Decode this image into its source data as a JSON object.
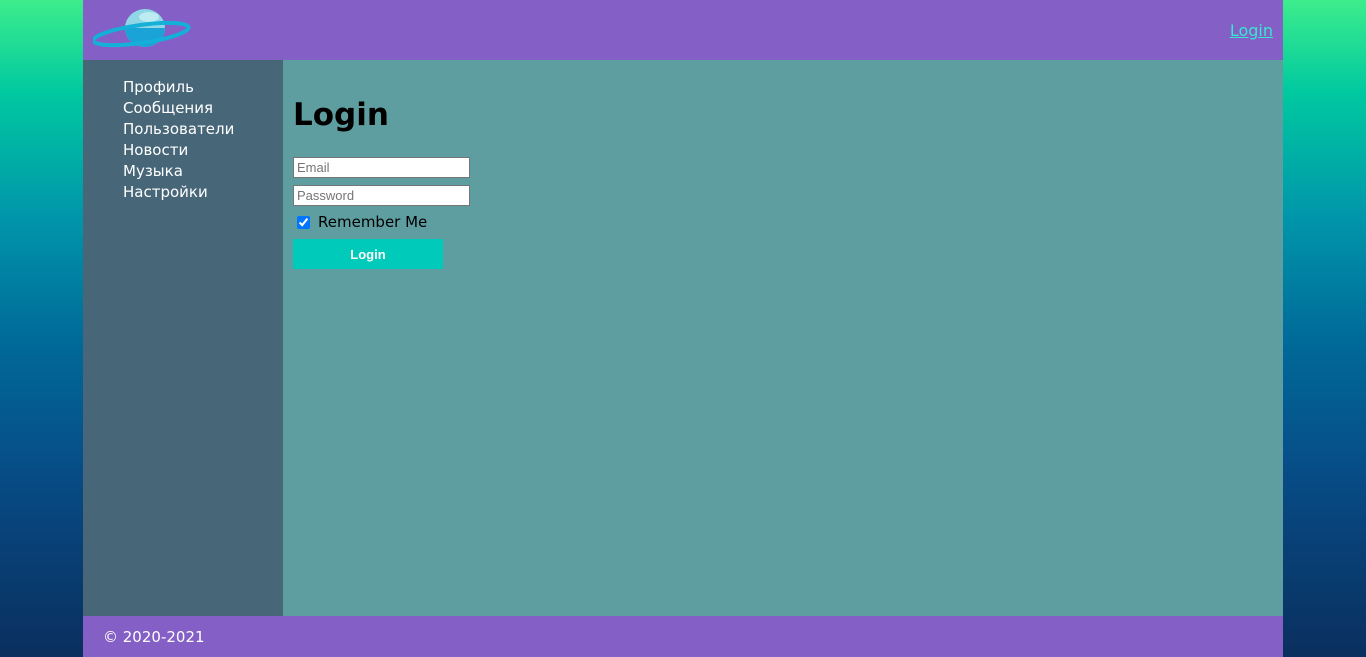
{
  "header": {
    "logo_icon": "planet-logo-icon",
    "login_link": "Login"
  },
  "sidebar": {
    "items": [
      {
        "label": "Профиль"
      },
      {
        "label": "Сообщения"
      },
      {
        "label": "Пользователи"
      },
      {
        "label": "Новости"
      },
      {
        "label": "Музыка"
      },
      {
        "label": "Настройки"
      }
    ]
  },
  "main": {
    "title": "Login",
    "email": {
      "value": "",
      "placeholder": "Email"
    },
    "password": {
      "value": "",
      "placeholder": "Password"
    },
    "remember": {
      "label": "Remember Me",
      "checked": true
    },
    "submit_label": "Login"
  },
  "footer": {
    "copyright": "© 2020-2021"
  },
  "colors": {
    "header_bg": "#845fc5",
    "sidebar_bg": "#476779",
    "main_bg": "#5f9ea0",
    "accent": "#00cbbb",
    "link": "#36e8d0"
  }
}
